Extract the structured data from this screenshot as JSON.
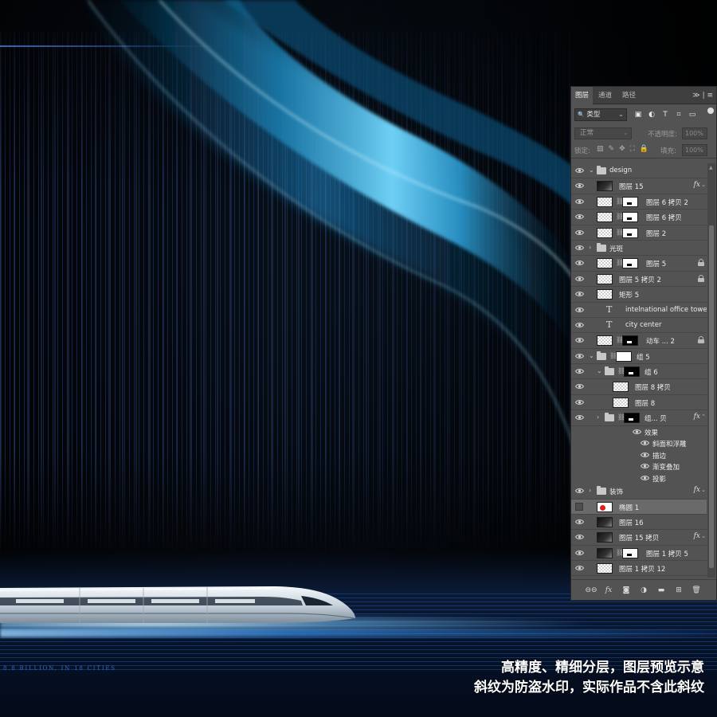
{
  "artwork": {
    "tagline": "8.8 BILLION, IN 18 CITIES",
    "watermark_line1": "高精度、精细分层，图层预览示意",
    "watermark_line2": "斜纹为防盗水印，实际作品不含此斜纹"
  },
  "panel": {
    "tabs": [
      {
        "label": "图层",
        "active": true
      },
      {
        "label": "通道",
        "active": false
      },
      {
        "label": "路径",
        "active": false
      }
    ],
    "tab_tools": "≫ | ≡",
    "filter": {
      "kind_label": "类型",
      "search_icon": "🔍"
    },
    "filter_icons": [
      "image-filter-icon",
      "adjustment-filter-icon",
      "type-filter-icon",
      "shape-filter-icon",
      "smart-object-filter-icon"
    ],
    "filter_icon_glyphs": [
      "▣",
      "◐",
      "T",
      "⌗",
      "▭"
    ],
    "blend_mode": "正常",
    "opacity_label": "不透明度:",
    "opacity_value": "100%",
    "lock_label": "锁定:",
    "lock_icons": [
      "▨",
      "✎",
      "✥",
      "⛶",
      "🔒"
    ],
    "fill_label": "填充:",
    "fill_value": "100%",
    "layers": [
      {
        "name": "design",
        "type": "group",
        "expanded": true,
        "indent": 0,
        "eye": true
      },
      {
        "name": "图层 15",
        "type": "pixel",
        "thumb": "dark",
        "indent": 0,
        "eye": true,
        "fx": true
      },
      {
        "name": "图层 6 拷贝 2",
        "type": "masked",
        "mask": "white",
        "indent": 0,
        "eye": true
      },
      {
        "name": "图层 6 拷贝",
        "type": "masked",
        "mask": "white",
        "indent": 0,
        "eye": true
      },
      {
        "name": "图层 2",
        "type": "masked",
        "mask": "white",
        "indent": 0,
        "eye": true
      },
      {
        "name": "光斑",
        "type": "group",
        "expanded": false,
        "indent": 0,
        "eye": true
      },
      {
        "name": "图层 5",
        "type": "masked",
        "mask": "white",
        "indent": 0,
        "eye": true,
        "locked": true
      },
      {
        "name": "图层 5 拷贝 2",
        "type": "pixel",
        "indent": 0,
        "eye": true,
        "locked": true
      },
      {
        "name": "矩形 5",
        "type": "shape",
        "indent": 0,
        "eye": true
      },
      {
        "name": "intelnational office tower",
        "type": "text",
        "indent": 0,
        "eye": true
      },
      {
        "name": "city center",
        "type": "text",
        "indent": 0,
        "eye": true
      },
      {
        "name": "动车 ... 2",
        "type": "masked",
        "mask": "black",
        "indent": 0,
        "eye": true,
        "locked": true
      },
      {
        "name": "组 5",
        "type": "group",
        "expanded": true,
        "indent": 0,
        "eye": true,
        "mask": "white"
      },
      {
        "name": "组 6",
        "type": "group",
        "expanded": true,
        "indent": 1,
        "eye": true,
        "mask": "black"
      },
      {
        "name": "图层 8 拷贝",
        "type": "pixel",
        "indent": 2,
        "eye": true
      },
      {
        "name": "图层 8",
        "type": "pixel",
        "indent": 2,
        "eye": true
      },
      {
        "name": "组... 贝",
        "type": "group",
        "expanded": false,
        "indent": 1,
        "eye": true,
        "mask": "black",
        "fx": true
      },
      {
        "name": "效果",
        "type": "effect-header",
        "indent": 3,
        "eye": true
      },
      {
        "name": "斜面和浮雕",
        "type": "effect",
        "indent": 4,
        "eye": true
      },
      {
        "name": "描边",
        "type": "effect",
        "indent": 4,
        "eye": true
      },
      {
        "name": "渐变叠加",
        "type": "effect",
        "indent": 4,
        "eye": true
      },
      {
        "name": "投影",
        "type": "effect",
        "indent": 4,
        "eye": true
      },
      {
        "name": "装饰",
        "type": "group",
        "expanded": false,
        "indent": 0,
        "eye": true,
        "fx": true
      },
      {
        "name": "椭圆 1",
        "type": "ellipse",
        "indent": 0,
        "eye": false,
        "selected": true
      },
      {
        "name": "图层 16",
        "type": "pixel",
        "thumb": "dark",
        "indent": 0,
        "eye": true
      },
      {
        "name": "图层 15 拷贝",
        "type": "pixel",
        "thumb": "dark",
        "indent": 0,
        "eye": true,
        "fx": true
      },
      {
        "name": "图层 1 拷贝 5",
        "type": "masked",
        "mask": "white",
        "thumb": "dark",
        "indent": 0,
        "eye": true
      },
      {
        "name": "图层 1 拷贝 12",
        "type": "pixel",
        "indent": 0,
        "eye": true
      }
    ],
    "footer_icons": [
      {
        "name": "link-layers-icon",
        "glyph": "⊖⊖"
      },
      {
        "name": "add-style-icon",
        "glyph": "fx"
      },
      {
        "name": "add-mask-icon",
        "glyph": "◙"
      },
      {
        "name": "new-adjustment-icon",
        "glyph": "◑"
      },
      {
        "name": "new-group-icon",
        "glyph": "▬"
      },
      {
        "name": "new-layer-icon",
        "glyph": "⊞"
      },
      {
        "name": "delete-layer-icon",
        "glyph": "🗑"
      }
    ]
  }
}
